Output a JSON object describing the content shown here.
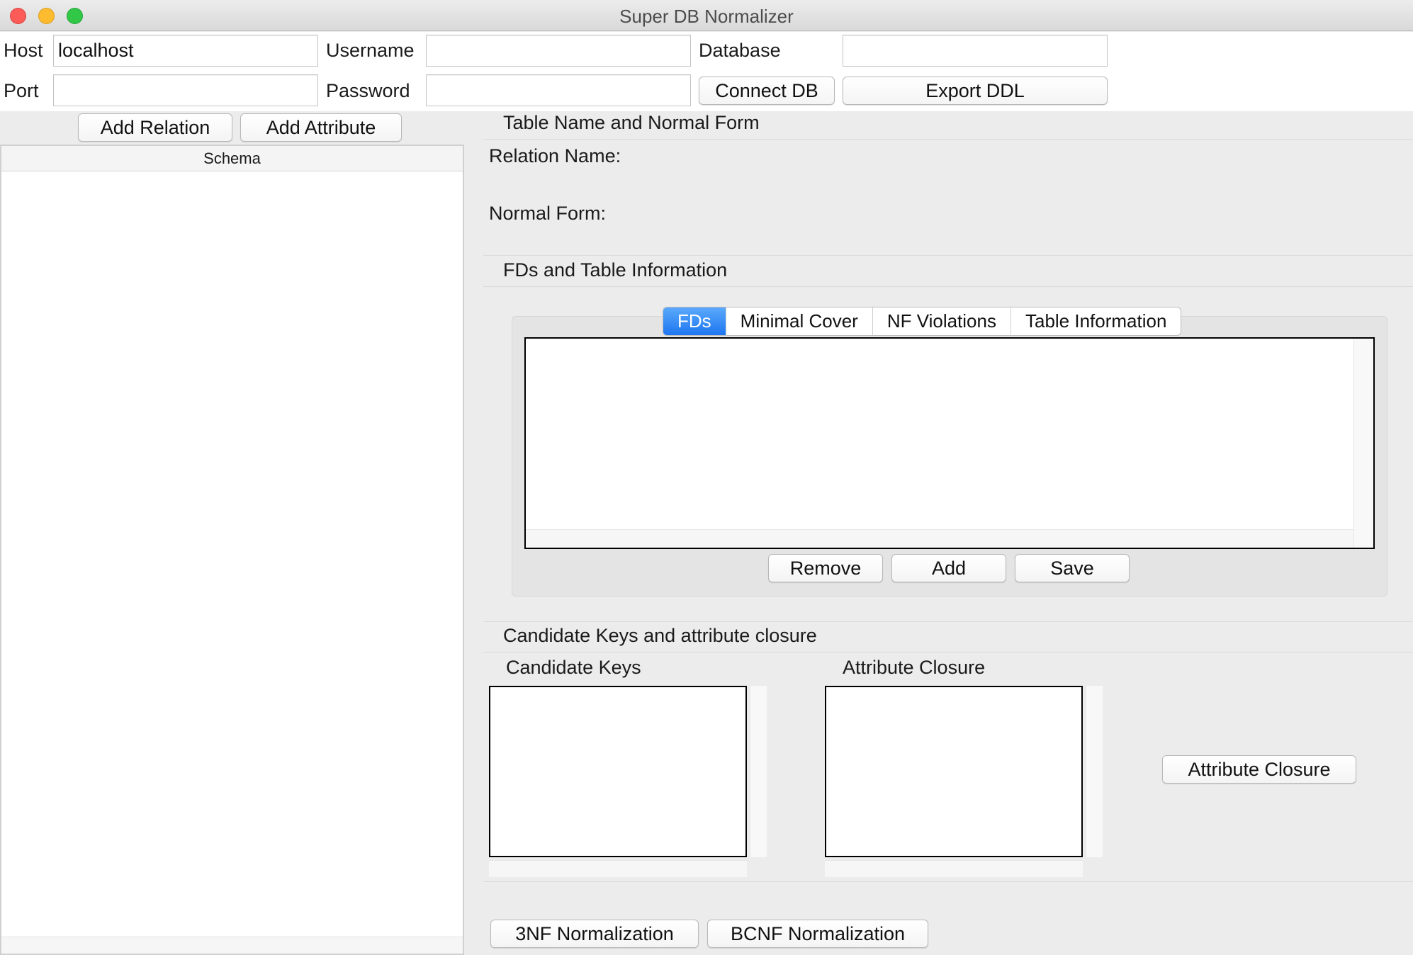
{
  "window": {
    "title": "Super DB Normalizer"
  },
  "connection": {
    "host_label": "Host",
    "host_value": "localhost",
    "port_label": "Port",
    "port_value": "",
    "username_label": "Username",
    "username_value": "",
    "password_label": "Password",
    "password_value": "",
    "database_label": "Database",
    "database_value": "",
    "connect_button": "Connect DB",
    "export_button": "Export DDL"
  },
  "schema_toolbar": {
    "add_relation": "Add Relation",
    "add_attribute": "Add Attribute"
  },
  "schema": {
    "header": "Schema",
    "items": []
  },
  "table_section": {
    "title": "Table Name and Normal Form",
    "relation_name_label": "Relation Name:",
    "relation_name_value": "",
    "normal_form_label": "Normal Form:",
    "normal_form_value": ""
  },
  "fd_section": {
    "title": "FDs and Table Information",
    "tabs": [
      "FDs",
      "Minimal Cover",
      "NF Violations",
      "Table Information"
    ],
    "active_tab": "FDs",
    "remove_button": "Remove",
    "add_button": "Add",
    "save_button": "Save"
  },
  "keys_section": {
    "title": "Candidate Keys and attribute closure",
    "candidate_keys_label": "Candidate Keys",
    "attribute_closure_label": "Attribute Closure",
    "attribute_closure_button": "Attribute Closure"
  },
  "normalization": {
    "nf3_button": "3NF Normalization",
    "bcnf_button": "BCNF Normalization"
  },
  "colors": {
    "active_tab": "#1e76f0",
    "window_background": "#ececec",
    "close_light": "#fc5b57",
    "minimize_light": "#fdbb2f",
    "maximize_light": "#33c748"
  }
}
